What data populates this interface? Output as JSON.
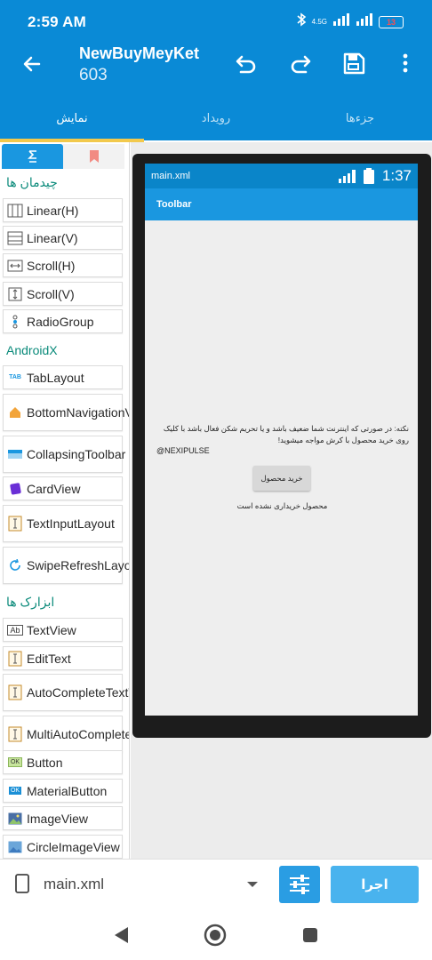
{
  "status_bar": {
    "time": "2:59 AM",
    "network": "4.5G",
    "battery": "13"
  },
  "app_bar": {
    "title": "NewBuyMeyKet",
    "subtitle": "603"
  },
  "tabs": [
    {
      "label": "نمایش",
      "active": true
    },
    {
      "label": "رویداد",
      "active": false
    },
    {
      "label": "جزءها",
      "active": false
    }
  ],
  "palette": {
    "layouts_header": "چیدمان ها",
    "layouts": [
      "Linear(H)",
      "Linear(V)",
      "Scroll(H)",
      "Scroll(V)",
      "RadioGroup"
    ],
    "androidx_header": "AndroidX",
    "androidx": [
      "TabLayout",
      "BottomNavigationView",
      "CollapsingToolbar",
      "CardView",
      "TextInputLayout",
      "SwipeRefreshLayout"
    ],
    "widgets_header": "ابزارک ها",
    "widgets": [
      "TextView",
      "EditText",
      "AutoCompleteTextView",
      "MultiAutoCompleteTextView",
      "Button",
      "MaterialButton",
      "ImageView",
      "CircleImageView"
    ]
  },
  "preview": {
    "filename": "main.xml",
    "time": "1:37",
    "toolbar_title": "Toolbar",
    "notice": "نکته: در صورتی که اینترنت شما ضعیف باشد و یا تحریم شکن فعال باشد با کلیک روی خرید محصول با کرش مواجه میشوید!",
    "tag": "@NEXIPULSE",
    "buy_button": "خرید محصول",
    "purchase_status": "محصول خریداری نشده است"
  },
  "bottom_bar": {
    "file": "main.xml",
    "run_label": "اجرا"
  },
  "colors": {
    "primary": "#0a8ad6",
    "accent": "#f2c94c",
    "section": "#0a8a7a"
  }
}
